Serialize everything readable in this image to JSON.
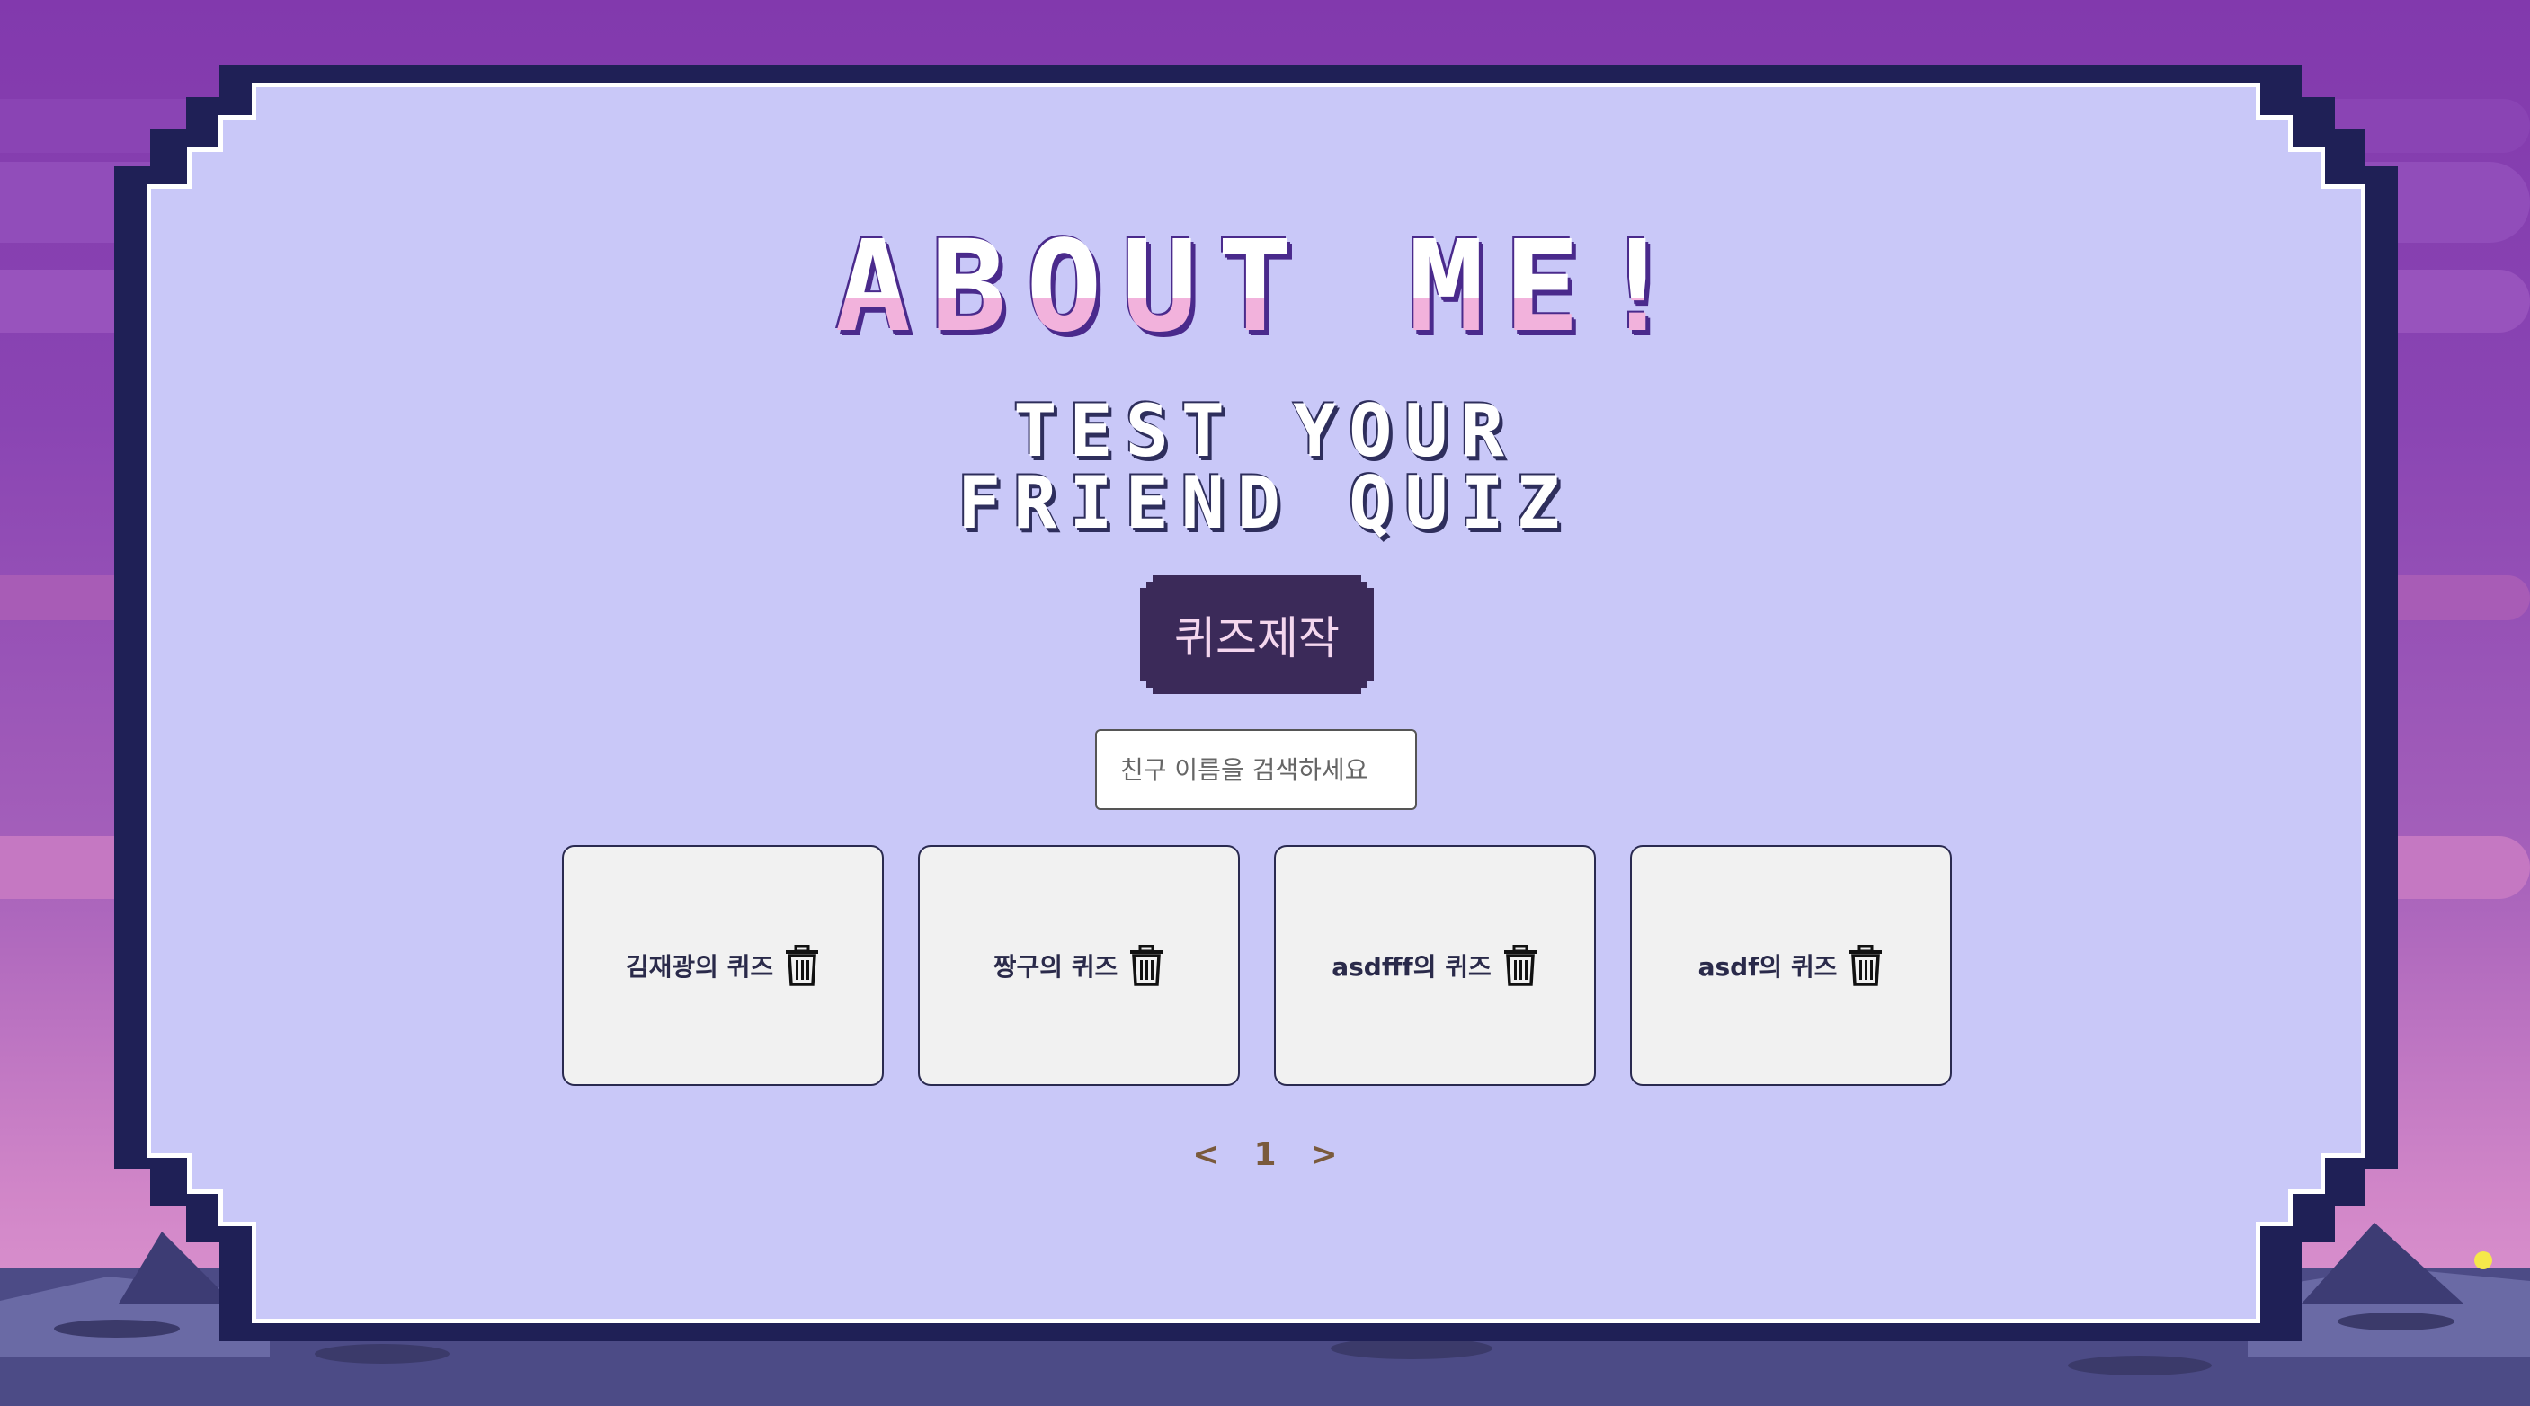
{
  "header": {
    "title": "ABOUT ME!",
    "subtitle_line1": "TEST YOUR",
    "subtitle_line2": "FRIEND QUIZ"
  },
  "actions": {
    "create_quiz_label": "퀴즈제작"
  },
  "search": {
    "placeholder": "친구 이름을 검색하세요",
    "value": ""
  },
  "quizzes": [
    {
      "label": "김재광의 퀴즈",
      "delete_icon": "trash-icon"
    },
    {
      "label": "짱구의 퀴즈",
      "delete_icon": "trash-icon"
    },
    {
      "label": "asdfff의 퀴즈",
      "delete_icon": "trash-icon"
    },
    {
      "label": "asdf의 퀴즈",
      "delete_icon": "trash-icon"
    }
  ],
  "pagination": {
    "prev": "<",
    "current": "1",
    "next": ">"
  },
  "colors": {
    "frame": "#1f2056",
    "panel": "#c9c8f8",
    "button": "#3b2a59",
    "title_pink": "#f2b2dc",
    "pager": "#7a5a3c"
  }
}
